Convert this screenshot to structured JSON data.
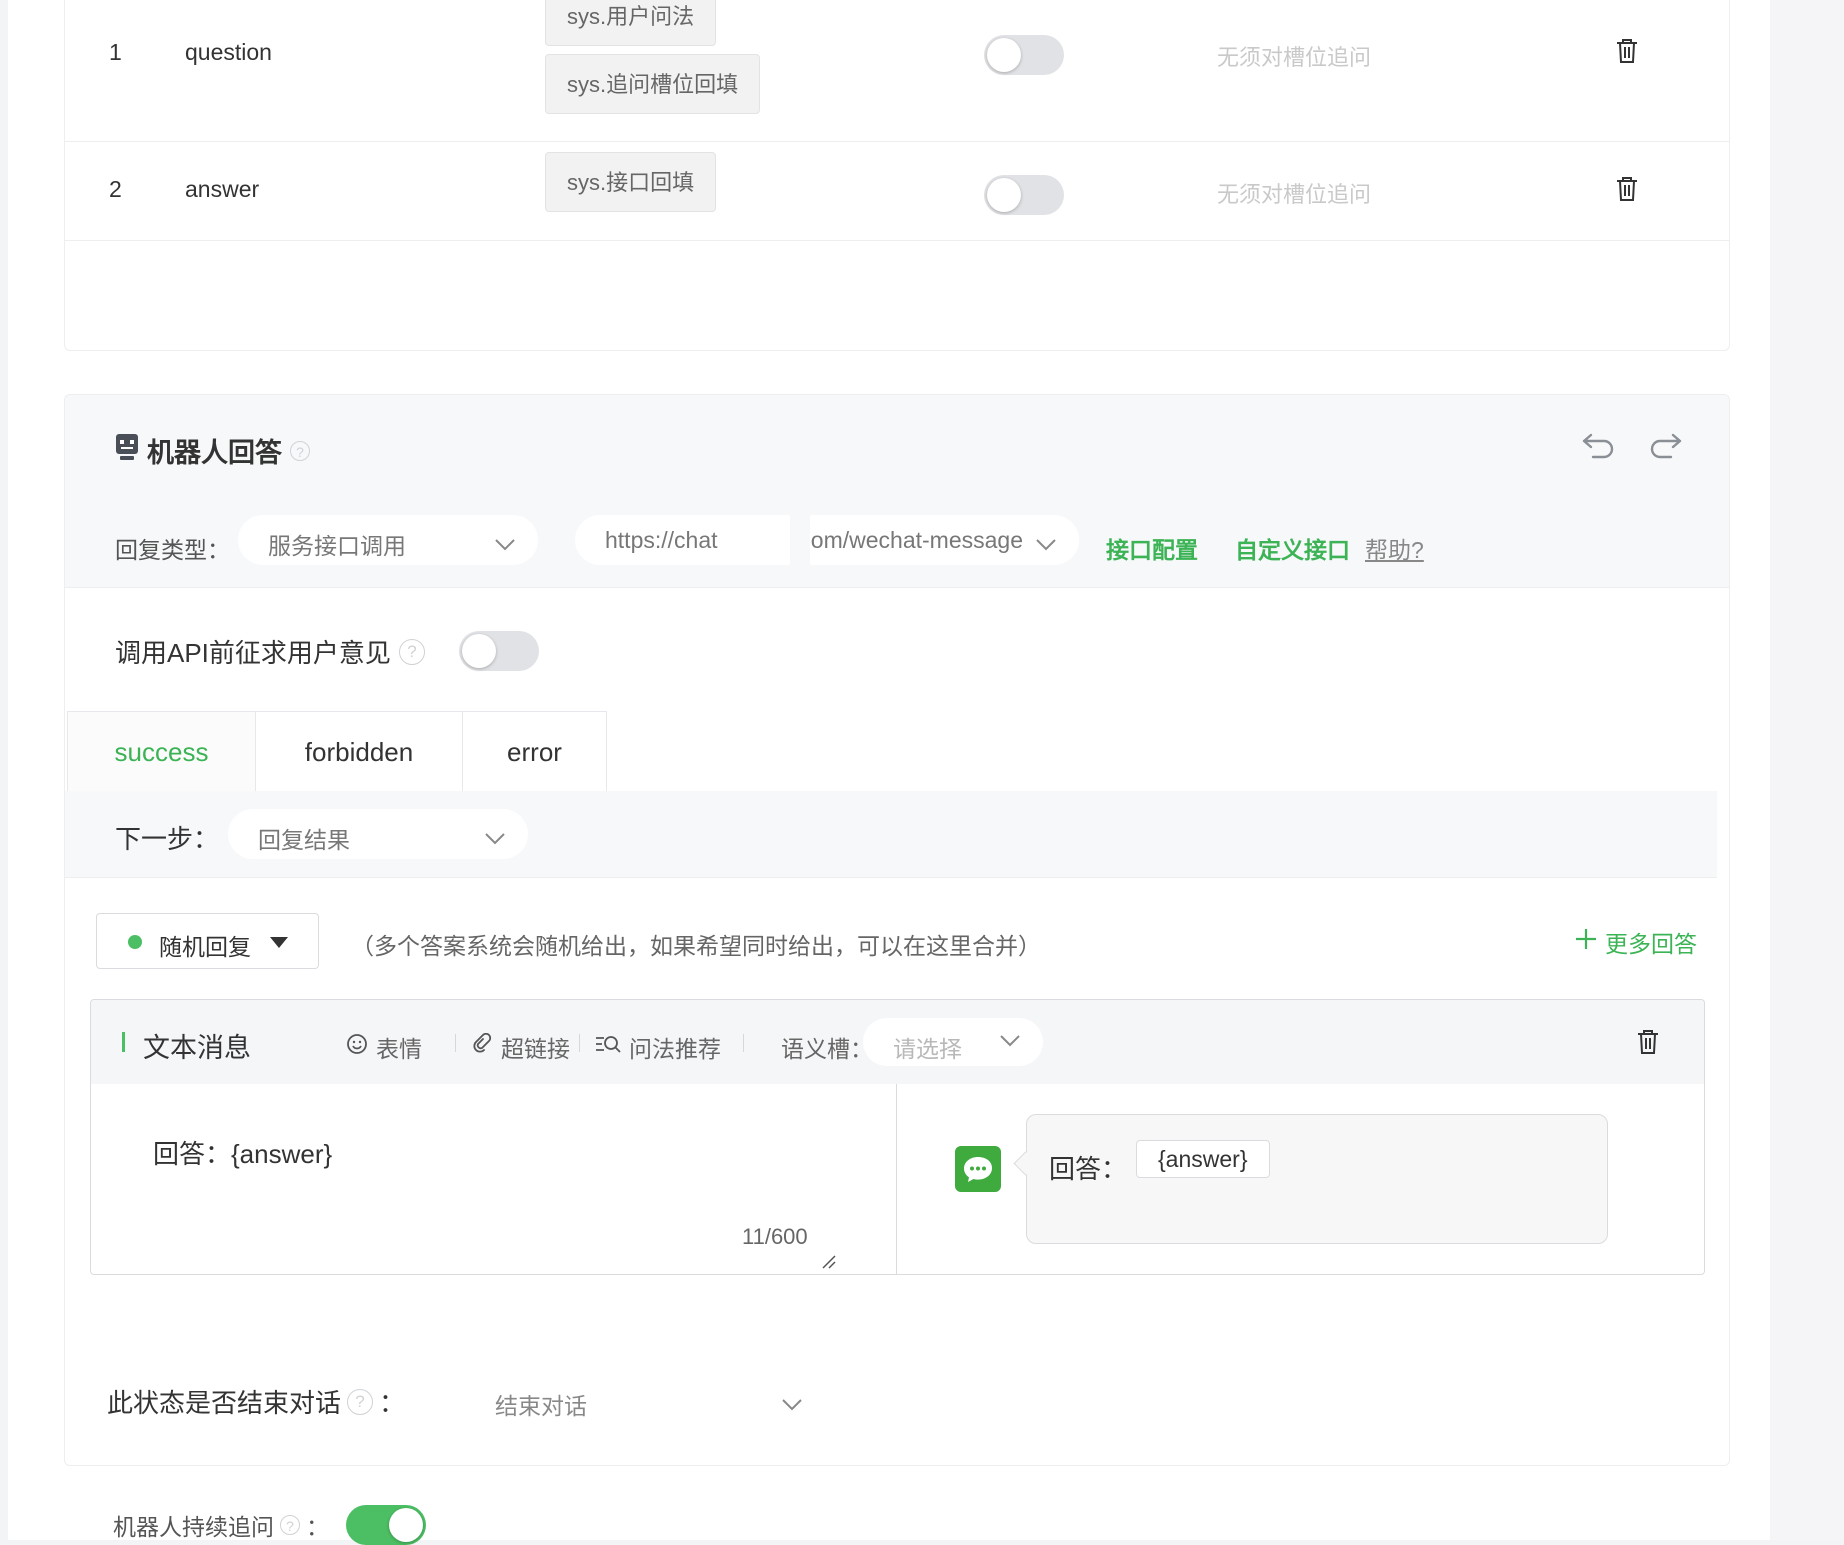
{
  "slot_table": {
    "rows": [
      {
        "index": "1",
        "name": "question",
        "chips": [
          "sys.用户问法",
          "sys.追问槽位回填"
        ],
        "ask_on": false,
        "ask_text": "无须对槽位追问"
      },
      {
        "index": "2",
        "name": "answer",
        "chips": [
          "sys.接口回填"
        ],
        "ask_on": false,
        "ask_text": "无须对槽位追问"
      }
    ]
  },
  "bot_answer": {
    "title": "机器人回答",
    "reply_type_label": "回复类型：",
    "reply_type_value": "服务接口调用",
    "url_left": "https://chat",
    "url_right": "..com/wechat-message",
    "link_config": "接口配置",
    "link_custom": "自定义接口",
    "link_help": "帮助?",
    "consent_label": "调用API前征求用户意见",
    "consent_on": false,
    "tabs": [
      {
        "label": "success",
        "active": true
      },
      {
        "label": "forbidden",
        "active": false
      },
      {
        "label": "error",
        "active": false
      }
    ],
    "next_label": "下一步：",
    "next_value": "回复结果",
    "random_label": "随机回复",
    "random_hint": "（多个答案系统会随机给出，如果希望同时给出，可以在这里合并）",
    "more_answers": "更多回答",
    "message": {
      "title": "文本消息",
      "tools": [
        "表情",
        "超链接",
        "问法推荐"
      ],
      "slot_label": "语义槽：",
      "slot_placeholder": "请选择",
      "content": "回答：{answer}",
      "counter": "11/600",
      "preview_prefix": "回答：",
      "preview_var": "{answer}"
    },
    "end_label": "此状态是否结束对话",
    "end_colon": "：",
    "end_value": "结束对话"
  },
  "followup": {
    "label": "机器人持续追问",
    "colon": "：",
    "on": true
  },
  "colors": {
    "accent_green": "#3cb355",
    "toggle_on": "#4cbe63",
    "toggle_off": "#e1e2e5",
    "wechat_green": "#3faa3d"
  },
  "icons": [
    "trash-icon",
    "robot-icon",
    "help-icon",
    "undo-icon",
    "redo-icon",
    "chevron-down-icon",
    "caret-down-icon",
    "plus-icon",
    "smile-icon",
    "link-icon",
    "search-suggest-icon",
    "resize-handle-icon",
    "wechat-icon"
  ]
}
